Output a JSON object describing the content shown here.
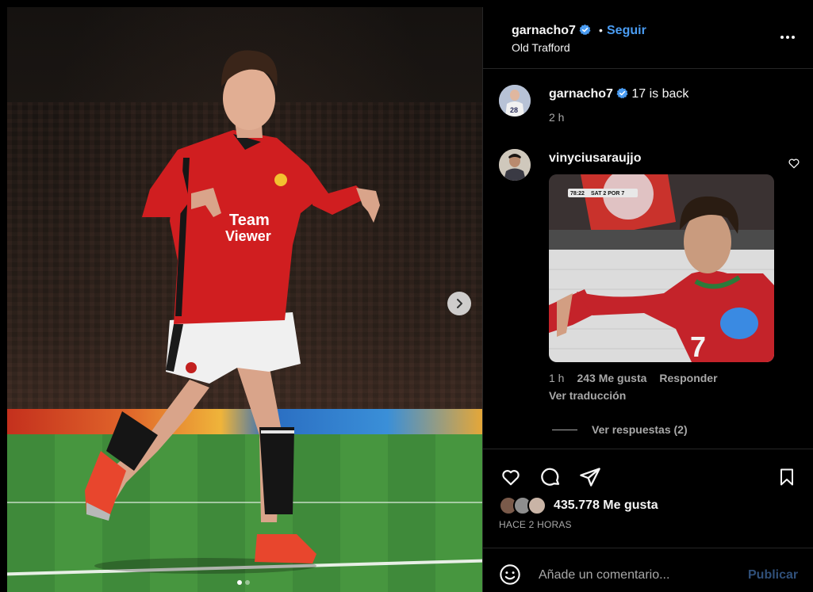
{
  "post": {
    "username": "garnacho7",
    "follow_label": "Seguir",
    "separator": "•",
    "location": "Old Trafford"
  },
  "caption": {
    "username": "garnacho7",
    "text": "17 is back",
    "time": "2 h"
  },
  "comment": {
    "username": "vinyciusaraujjo",
    "time": "1 h",
    "likes": "243 Me gusta",
    "reply_label": "Responder",
    "translate_label": "Ver traducción",
    "view_replies": "Ver respuestas (2)",
    "gif": {
      "score_text": "SAT 2 POR 7",
      "clock_text": "78:22",
      "shirt_number": "7"
    }
  },
  "engagement": {
    "likes_total": "435.778 Me gusta",
    "posted": "HACE 2 HORAS"
  },
  "composer": {
    "placeholder": "Añade un comentario...",
    "publish_label": "Publicar"
  },
  "icons": {
    "verified": "verified-badge-icon",
    "more": "more-options-icon",
    "like": "heart-icon",
    "comment": "comment-icon",
    "share": "send-icon",
    "save": "bookmark-icon",
    "emoji": "emoji-icon",
    "next": "chevron-right-icon"
  },
  "colors": {
    "accent": "#4a9cf2",
    "background": "#000000",
    "secondary_text": "#a8a8a8",
    "publish_disabled": "#30507a"
  },
  "media": {
    "slide_count": 2,
    "active_slide": 1,
    "jersey_sponsor": "Team Viewer"
  }
}
